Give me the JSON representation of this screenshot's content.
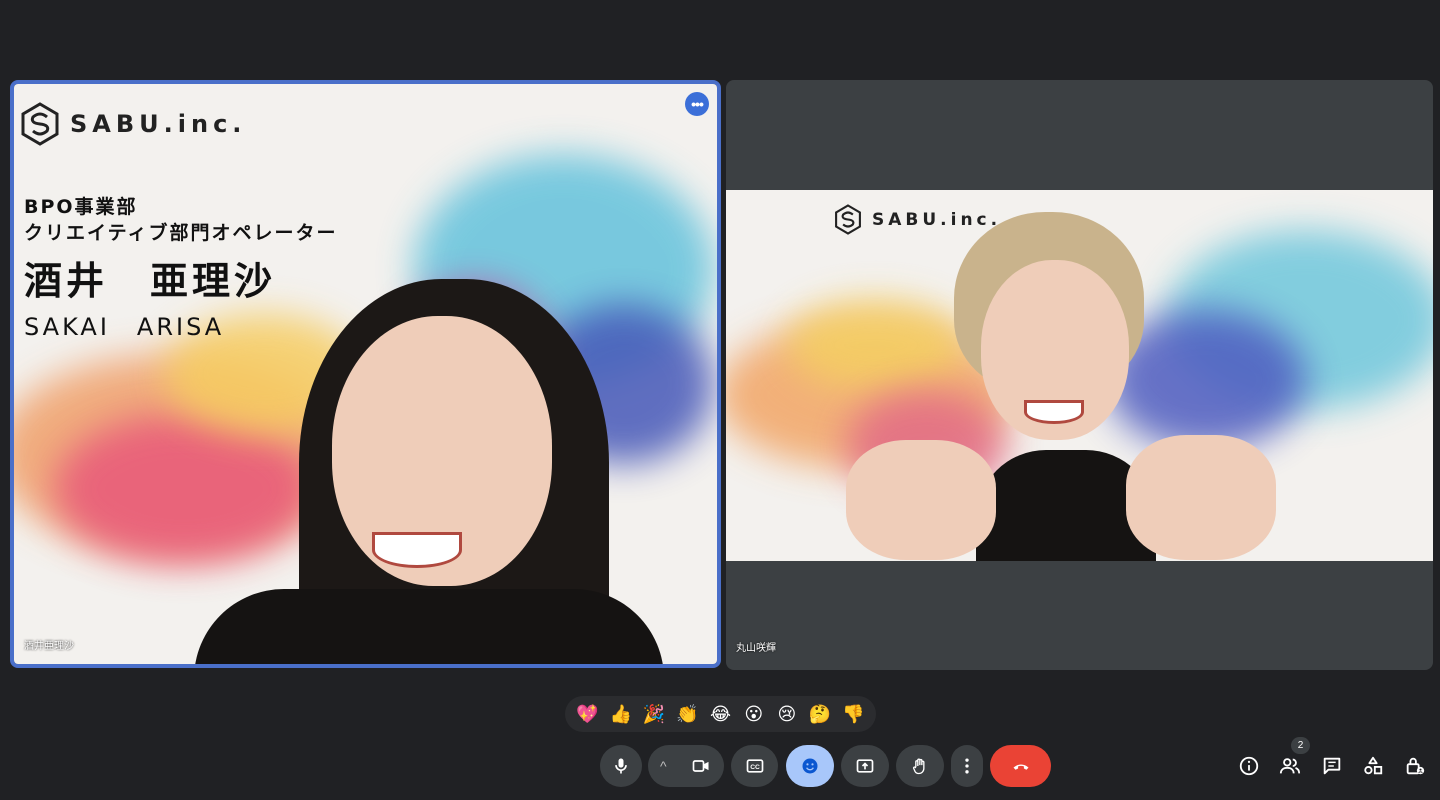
{
  "participants": [
    {
      "name": "酒井亜理沙",
      "background": {
        "brand": "SABU.inc.",
        "department_line1": "BPO事業部",
        "department_line2": "クリエイティブ部門オペレーター",
        "name_jp": "酒井　亜理沙",
        "name_en": "SAKAI　ARISA"
      },
      "more_options": "•••",
      "active_speaker": true
    },
    {
      "name": "丸山咲輝",
      "background": {
        "brand": "SABU.inc."
      }
    }
  ],
  "reactions": [
    "💖",
    "👍",
    "🎉",
    "👏",
    "😂",
    "😮",
    "😢",
    "🤔",
    "👎"
  ],
  "controls": {
    "mic": "mic-icon",
    "chevron": "^",
    "camera": "camera-icon",
    "captions": "CC",
    "emoji": "emoji-icon",
    "present": "present-icon",
    "raise_hand": "hand-icon",
    "more": "more-vert-icon",
    "end_call": "end-call-icon"
  },
  "side_panel": {
    "people_count": "2"
  },
  "colors": {
    "background": "#202124",
    "tile": "#3c4043",
    "active_border": "#4a6fc9",
    "end_call": "#ea4335",
    "emoji_active": "#a8c7fa"
  }
}
